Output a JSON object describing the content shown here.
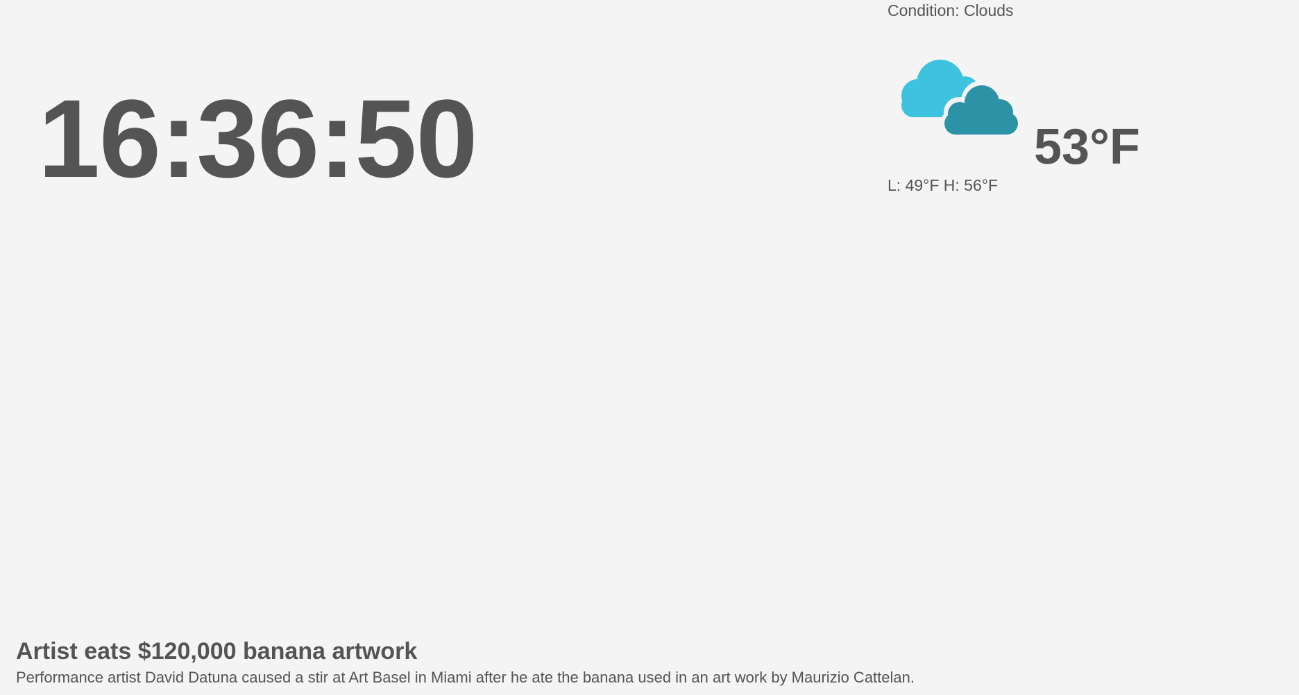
{
  "clock": {
    "time": "16:36:50"
  },
  "weather": {
    "condition": "Condition: Clouds",
    "icon": "clouds-icon",
    "temperature": "53°F",
    "low_high": "L: 49°F H: 56°F",
    "colors": {
      "cloud_light": "#3ec3de",
      "cloud_dark": "#2c93a6"
    }
  },
  "news": {
    "headline": "Artist eats $120,000 banana artwork",
    "summary": "Performance artist David Datuna caused a stir at Art Basel in Miami after he ate the banana used in an art work by Maurizio Cattelan."
  },
  "colors": {
    "background": "#f4f4f4",
    "text": "#545454"
  }
}
